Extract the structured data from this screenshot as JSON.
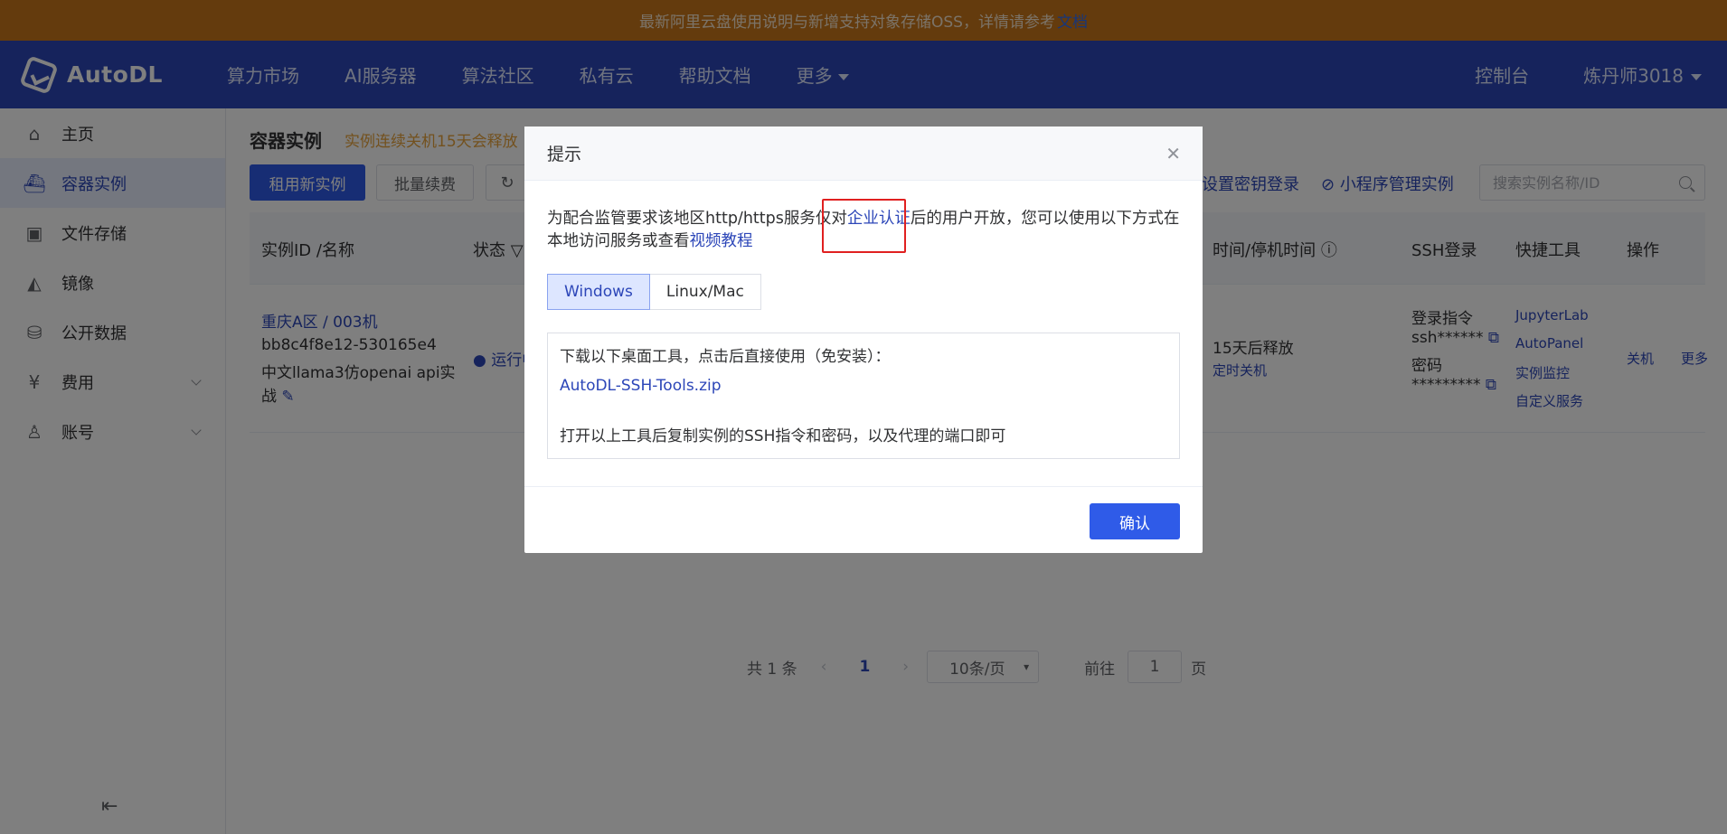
{
  "announcement": {
    "text": "最新阿里云盘使用说明与新增支持对象存储OSS，详情请参考",
    "link": "文档"
  },
  "header": {
    "logo": "AutoDL",
    "nav": [
      "算力市场",
      "AI服务器",
      "算法社区",
      "私有云",
      "帮助文档",
      "更多"
    ],
    "console": "控制台",
    "user": "炼丹师3018"
  },
  "sidebar": {
    "items": [
      {
        "label": "主页",
        "icon": "home-icon"
      },
      {
        "label": "容器实例",
        "icon": "container-icon",
        "active": true
      },
      {
        "label": "文件存储",
        "icon": "storage-icon"
      },
      {
        "label": "镜像",
        "icon": "image-icon"
      },
      {
        "label": "公开数据",
        "icon": "database-icon"
      },
      {
        "label": "费用",
        "icon": "yen-icon",
        "expandable": true
      },
      {
        "label": "账号",
        "icon": "user-icon",
        "expandable": true
      }
    ]
  },
  "main": {
    "title": "容器实例",
    "warning": "实例连续关机15天会释放",
    "buttons": {
      "rent": "租用新实例",
      "renew": "批量续费"
    },
    "links": {
      "ssh_key": "设置密钥登录",
      "miniprogram": "小程序管理实例"
    },
    "search_placeholder": "搜索实例名称/ID",
    "columns": {
      "id_name": "实例ID /名称",
      "status": "状态",
      "time": "时间/停机时间",
      "ssh": "SSH登录",
      "tools": "快捷工具",
      "ops": "操作"
    },
    "row": {
      "region": "重庆A区 / 003机",
      "id": "bb8c4f8e12-530165e4",
      "name_line1": "中文llama3仿openai api实",
      "name_line2": "战",
      "status": "运行中",
      "release": "15天后释放",
      "shutdown": "定时关机",
      "ssh_cmd_label": "登录指令",
      "ssh_cmd": "ssh******",
      "pwd_label": "密码",
      "pwd": "*********",
      "tools": [
        "JupyterLab",
        "AutoPanel",
        "实例监控",
        "自定义服务"
      ],
      "op_shutdown": "关机",
      "op_more": "更多"
    },
    "pager": {
      "total": "共 1 条",
      "page": "1",
      "size": "10条/页",
      "goto": "前往",
      "goto_value": "1",
      "unit": "页"
    }
  },
  "dialog": {
    "title": "提示",
    "msg_part1": "为配合监管要求该地区http/https服务仅对",
    "msg_highlight": "企业认证",
    "msg_part2": "后的用户开放，您可以使用以下方式在本地访问服务或查看",
    "msg_link": "视频教程",
    "tabs": [
      "Windows",
      "Linux/Mac"
    ],
    "box_line1": "下载以下桌面工具，点击后直接使用（免安装）：",
    "box_link": "AutoDL-SSH-Tools.zip",
    "box_line3": "打开以上工具后复制实例的SSH指令和密码，以及代理的端口即可",
    "confirm": "确认"
  },
  "colors": {
    "header": "#2c46b8",
    "announce": "#c8761a",
    "primary": "#2f5be8",
    "highlight_box": "#e02020"
  }
}
